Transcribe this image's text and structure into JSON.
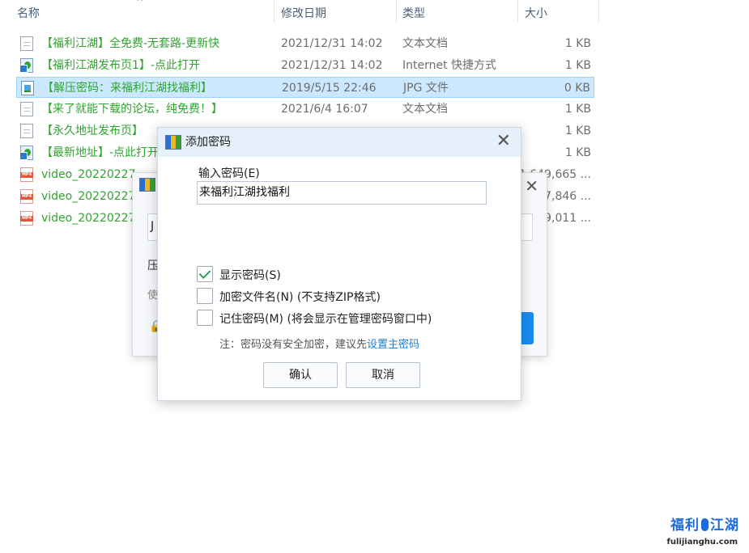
{
  "columns": {
    "name": "名称",
    "modified": "修改日期",
    "type": "类型",
    "size": "大小"
  },
  "files": [
    {
      "name": "【福利江湖】全免费-无套路-更新快",
      "date": "2021/12/31 14:02",
      "type": "文本文档",
      "size": "1 KB",
      "icon": "text-file-icon"
    },
    {
      "name": "【福利江湖发布页1】-点此打开",
      "date": "2021/12/31 14:02",
      "type": "Internet 快捷方式",
      "size": "1 KB",
      "icon": "internet-shortcut-icon"
    },
    {
      "name": "【解压密码：来福利江湖找福利】",
      "date": "2019/5/15 22:46",
      "type": "JPG 文件",
      "size": "0 KB",
      "icon": "jpg-file-icon",
      "selected": true
    },
    {
      "name": "【来了就能下载的论坛，纯免费！】",
      "date": "2021/6/4 16:07",
      "type": "文本文档",
      "size": "1 KB",
      "icon": "text-file-icon"
    },
    {
      "name": "【永久地址发布页】",
      "date": "",
      "type": "",
      "size": "1 KB",
      "icon": "text-file-icon"
    },
    {
      "name": "【最新地址】-点此打开",
      "date": "",
      "type": "",
      "size": "1 KB",
      "icon": "internet-shortcut-icon"
    },
    {
      "name": "video_20220227_",
      "date": "",
      "type": "",
      "size": "1,649,665 ...",
      "icon": "mp4-file-icon"
    },
    {
      "name": "video_20220227_",
      "date": "",
      "type": "",
      "size": "27,846 ...",
      "icon": "mp4-file-icon"
    },
    {
      "name": "video_20220227_",
      "date": "",
      "type": "",
      "size": "09,011 ...",
      "icon": "mp4-file-icon"
    }
  ],
  "back_dialog": {
    "field_text": "J",
    "line1": "压",
    "line2": "使"
  },
  "dialog": {
    "title": "添加密码",
    "password_label": "输入密码(E)",
    "password_value": "来福利江湖找福利",
    "show_password": {
      "label": "显示密码(S)",
      "checked": true
    },
    "encrypt_names": {
      "label": "加密文件名(N) (不支持ZIP格式)",
      "checked": false
    },
    "remember": {
      "label": "记住密码(M) (将会显示在管理密码窗口中)",
      "checked": false
    },
    "note_prefix": "注：密码没有安全加密，建议先",
    "note_link": "设置主密码",
    "ok": "确认",
    "cancel": "取消"
  },
  "watermark": {
    "left": "福利",
    "right": "江湖",
    "url": "fulijianghu.com"
  }
}
